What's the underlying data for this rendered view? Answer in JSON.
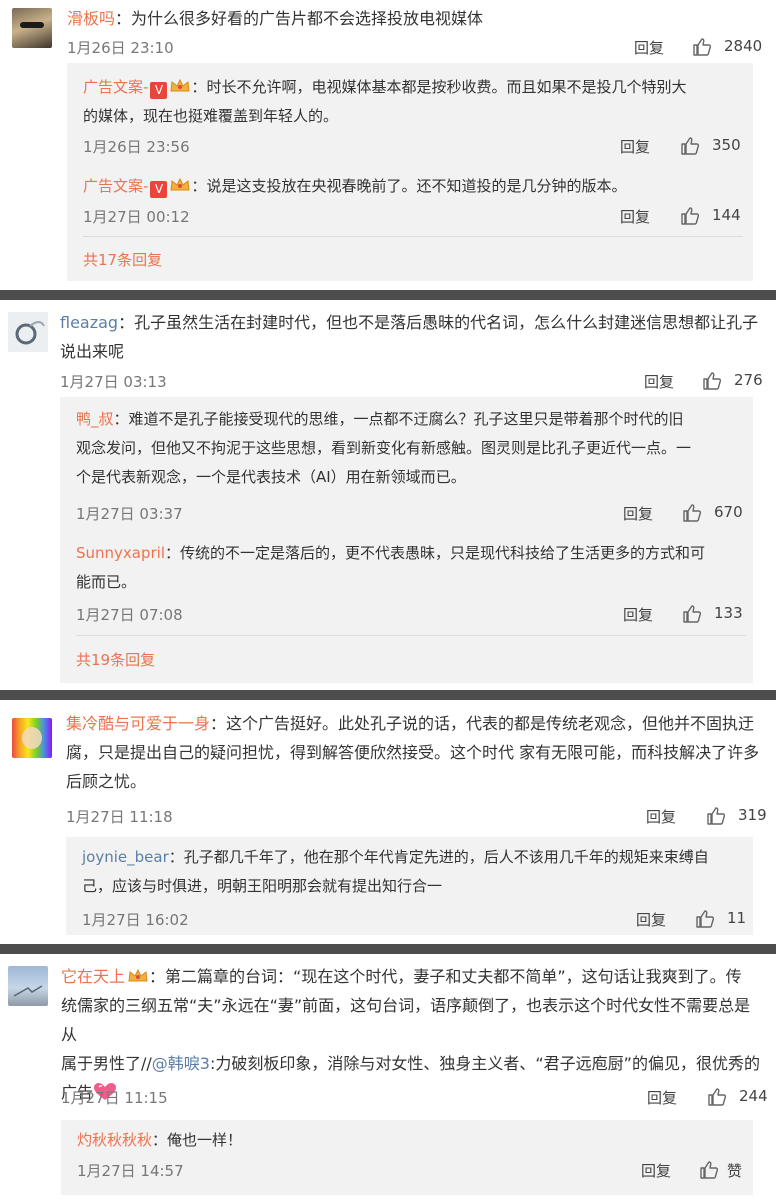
{
  "colors": {
    "username": "#eb7350",
    "link": "#5b7fa8",
    "separator": "#4d4d4d",
    "subpanel": "#f2f2f2"
  },
  "comments": [
    {
      "user": "滑板吗",
      "text": "为什么很多好看的广告片都不会选择投放电视媒体",
      "time": "1月26日 23:10",
      "reply_label": "回复",
      "likes": "2840",
      "replies": [
        {
          "user": "广告文案-",
          "line1": "时长不允许啊，电视媒体基本都是按秒收费。而且如果不是投几个特别大",
          "line2": "的媒体，现在也挺难覆盖到年轻人的。",
          "time": "1月26日 23:56",
          "reply_label": "回复",
          "likes": "350"
        },
        {
          "user": "广告文案-",
          "line1": "说是这支投放在央视春晚前了。还不知道投的是几分钟的版本。",
          "time": "1月27日 00:12",
          "reply_label": "回复",
          "likes": "144"
        }
      ],
      "more": "共17条回复"
    },
    {
      "user": "fleazag",
      "line1": "孔子虽然生活在封建时代，但也不是落后愚昧的代名词，怎么什么封建迷信思想都让孔子",
      "line2": "说出来呢",
      "time": "1月27日 03:13",
      "reply_label": "回复",
      "likes": "276",
      "replies": [
        {
          "user": "鸭_叔",
          "line1": "难道不是孔子能接受现代的思维，一点都不迂腐么？孔子这里只是带着那个时代的旧",
          "line2": "观念发问，但他又不拘泥于这些思想，看到新变化有新感触。图灵则是比孔子更近代一点。一",
          "line3": "个是代表新观念，一个是代表技术（AI）用在新领域而已。",
          "time": "1月27日 03:37",
          "reply_label": "回复",
          "likes": "670"
        },
        {
          "user": "Sunnyxapril",
          "line1": "传统的不一定是落后的，更不代表愚昧，只是现代科技给了生活更多的方式和可",
          "line2": "能而已。",
          "time": "1月27日 07:08",
          "reply_label": "回复",
          "likes": "133"
        }
      ],
      "more": "共19条回复"
    },
    {
      "user": "集冷酷与可爱于一身",
      "line1": "这个广告挺好。此处孔子说的话，代表的都是传统老观念，但他并不固执迂",
      "line2": "腐，只是提出自己的疑问担忧，得到解答便欣然接受。这个时代 家有无限可能，而科技解决了许多",
      "line3": "后顾之忧。",
      "time": "1月27日 11:18",
      "reply_label": "回复",
      "likes": "319",
      "replies": [
        {
          "user": "joynie_bear",
          "line1": "孔子都几千年了，他在那个年代肯定先进的，后人不该用几千年的规矩来束缚自",
          "line2": "己，应该与时俱进，明朝王阳明那会就有提出知行合一",
          "time": "1月27日 16:02",
          "reply_label": "回复",
          "likes": "11"
        }
      ]
    },
    {
      "user": "它在天上",
      "line1": "第二篇章的台词：“现在这个时代，妻子和丈夫都不简单”，这句话让我爽到了。传",
      "line2": "统儒家的三纲五常“夫”永远在“妻”前面，这句台词，语序颠倒了，也表示这个时代女性不需要总是从",
      "line3_a": "属于男性了//",
      "line3_mention": "@韩唳3",
      "line3_b": ":力破刻板印象，消除与对女性、独身主义者、“君子远庖厨”的偏见，很优秀的",
      "line4": "广告",
      "time": "1月27日 11:15",
      "reply_label": "回复",
      "likes": "244",
      "replies": [
        {
          "user": "灼秋秋秋秋",
          "line1": "俺也一样！",
          "time": "1月27日 14:57",
          "reply_label": "回复",
          "likes": "赞"
        }
      ]
    }
  ],
  "icons": {
    "verified": "verified-v-icon",
    "crown": "vip-crown-icon",
    "like": "thumb-up-icon",
    "heart": "heart-emoji-icon"
  }
}
